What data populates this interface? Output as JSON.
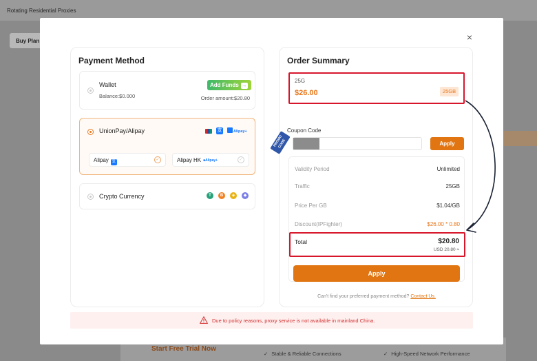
{
  "background": {
    "page_title": "Rotating Residential Proxies",
    "buy_plan_label": "Buy Plan",
    "trial_label": "Start Free Trial Now",
    "features": [
      "Stable & Reliable Connections",
      "High-Speed Network Performance"
    ]
  },
  "modal": {
    "close_label": "×",
    "payment": {
      "heading": "Payment Method",
      "wallet": {
        "label": "Wallet",
        "balance": "Balance:$0.000",
        "order_amount": "Order amount:$20.80",
        "add_funds": "Add Funds",
        "add_funds_arrow": "→"
      },
      "union": {
        "label": "UnionPay/Alipay",
        "selected": true,
        "sub_options": [
          {
            "label": "Alipay",
            "selected": true
          },
          {
            "label": "Alipay HK",
            "selected": false
          }
        ]
      },
      "crypto": {
        "label": "Crypto Currency",
        "coins": [
          {
            "name": "tether",
            "glyph": "T",
            "color": "#27a17a"
          },
          {
            "name": "bitcoin",
            "glyph": "B",
            "color": "#f2801f"
          },
          {
            "name": "binance",
            "glyph": "◈",
            "color": "#e9b213"
          },
          {
            "name": "ethereum",
            "glyph": "◆",
            "color": "#7b7fe8"
          }
        ]
      }
    },
    "summary": {
      "heading": "Order Summary",
      "plan": {
        "name": "25G",
        "price": "$26.00",
        "badge": "25GB"
      },
      "coupon": {
        "label": "Coupon Code",
        "apply": "Apply",
        "promo_tag": "PROMO CODE"
      },
      "rows": [
        {
          "key": "Validity Period",
          "value": "Unlimited"
        },
        {
          "key": "Traffic",
          "value": "25GB"
        },
        {
          "key": "Price Per GB",
          "value": "$1.04/GB"
        },
        {
          "key": "Discount(IPFighter)",
          "value": "$26.00 * 0.80"
        }
      ],
      "total": {
        "label": "Total",
        "value": "$20.80",
        "usd": "USD 20.80 ≈"
      },
      "apply_button": "Apply",
      "help_text": "Can't find your preferred payment method?",
      "help_link": "Contact Us."
    },
    "notice": "Due to policy reasons, proxy service is not available in mainland China."
  },
  "colors": {
    "accent": "#e07511",
    "highlight_border": "#d7152b",
    "notice_text": "#d32f2f"
  }
}
